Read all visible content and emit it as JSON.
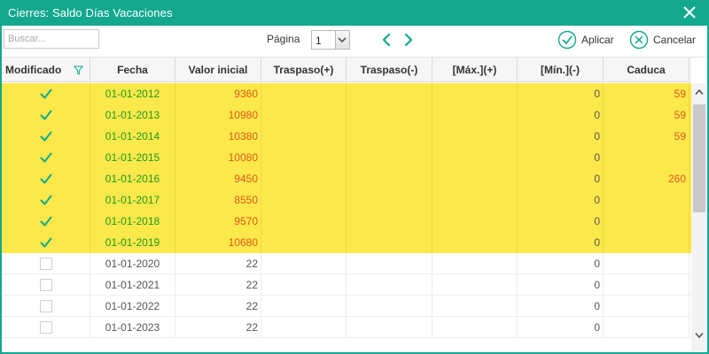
{
  "window": {
    "title": "Cierres: Saldo Días Vacaciones",
    "accent_color": "#13a88e",
    "close_icon": "close-icon"
  },
  "toolbar": {
    "search_placeholder": "Buscar...",
    "page_label": "Página",
    "page_value": "1",
    "apply_label": "Aplicar",
    "cancel_label": "Cancelar",
    "icons": [
      "chevron-left-icon",
      "chevron-right-icon",
      "check-circle-icon",
      "x-circle-icon",
      "filter-icon"
    ]
  },
  "grid": {
    "highlight_color": "#fbe84a",
    "columns": [
      {
        "key": "modificado",
        "label": "Modificado"
      },
      {
        "key": "fecha",
        "label": "Fecha"
      },
      {
        "key": "valor_inicial",
        "label": "Valor inicial"
      },
      {
        "key": "traspaso_mas",
        "label": "Traspaso(+)"
      },
      {
        "key": "traspaso_menos",
        "label": "Traspaso(-)"
      },
      {
        "key": "max_mas",
        "label": "[Máx.](+)"
      },
      {
        "key": "min_menos",
        "label": "[Mín.](-)"
      },
      {
        "key": "caduca",
        "label": "Caduca"
      }
    ],
    "rows": [
      {
        "modificado": true,
        "fecha": "01-01-2012",
        "valor_inicial": "9360",
        "traspaso_mas": "",
        "traspaso_menos": "",
        "max_mas": "",
        "min_menos": "0",
        "caduca": "59"
      },
      {
        "modificado": true,
        "fecha": "01-01-2013",
        "valor_inicial": "10980",
        "traspaso_mas": "",
        "traspaso_menos": "",
        "max_mas": "",
        "min_menos": "0",
        "caduca": "59"
      },
      {
        "modificado": true,
        "fecha": "01-01-2014",
        "valor_inicial": "10380",
        "traspaso_mas": "",
        "traspaso_menos": "",
        "max_mas": "",
        "min_menos": "0",
        "caduca": "59"
      },
      {
        "modificado": true,
        "fecha": "01-01-2015",
        "valor_inicial": "10080",
        "traspaso_mas": "",
        "traspaso_menos": "",
        "max_mas": "",
        "min_menos": "0",
        "caduca": ""
      },
      {
        "modificado": true,
        "fecha": "01-01-2016",
        "valor_inicial": "9450",
        "traspaso_mas": "",
        "traspaso_menos": "",
        "max_mas": "",
        "min_menos": "0",
        "caduca": "260"
      },
      {
        "modificado": true,
        "fecha": "01-01-2017",
        "valor_inicial": "8550",
        "traspaso_mas": "",
        "traspaso_menos": "",
        "max_mas": "",
        "min_menos": "0",
        "caduca": ""
      },
      {
        "modificado": true,
        "fecha": "01-01-2018",
        "valor_inicial": "9570",
        "traspaso_mas": "",
        "traspaso_menos": "",
        "max_mas": "",
        "min_menos": "0",
        "caduca": ""
      },
      {
        "modificado": true,
        "fecha": "01-01-2019",
        "valor_inicial": "10680",
        "traspaso_mas": "",
        "traspaso_menos": "",
        "max_mas": "",
        "min_menos": "0",
        "caduca": ""
      },
      {
        "modificado": false,
        "fecha": "01-01-2020",
        "valor_inicial": "22",
        "traspaso_mas": "",
        "traspaso_menos": "",
        "max_mas": "",
        "min_menos": "0",
        "caduca": ""
      },
      {
        "modificado": false,
        "fecha": "01-01-2021",
        "valor_inicial": "22",
        "traspaso_mas": "",
        "traspaso_menos": "",
        "max_mas": "",
        "min_menos": "0",
        "caduca": ""
      },
      {
        "modificado": false,
        "fecha": "01-01-2022",
        "valor_inicial": "22",
        "traspaso_mas": "",
        "traspaso_menos": "",
        "max_mas": "",
        "min_menos": "0",
        "caduca": ""
      },
      {
        "modificado": false,
        "fecha": "01-01-2023",
        "valor_inicial": "22",
        "traspaso_mas": "",
        "traspaso_menos": "",
        "max_mas": "",
        "min_menos": "0",
        "caduca": ""
      }
    ]
  }
}
